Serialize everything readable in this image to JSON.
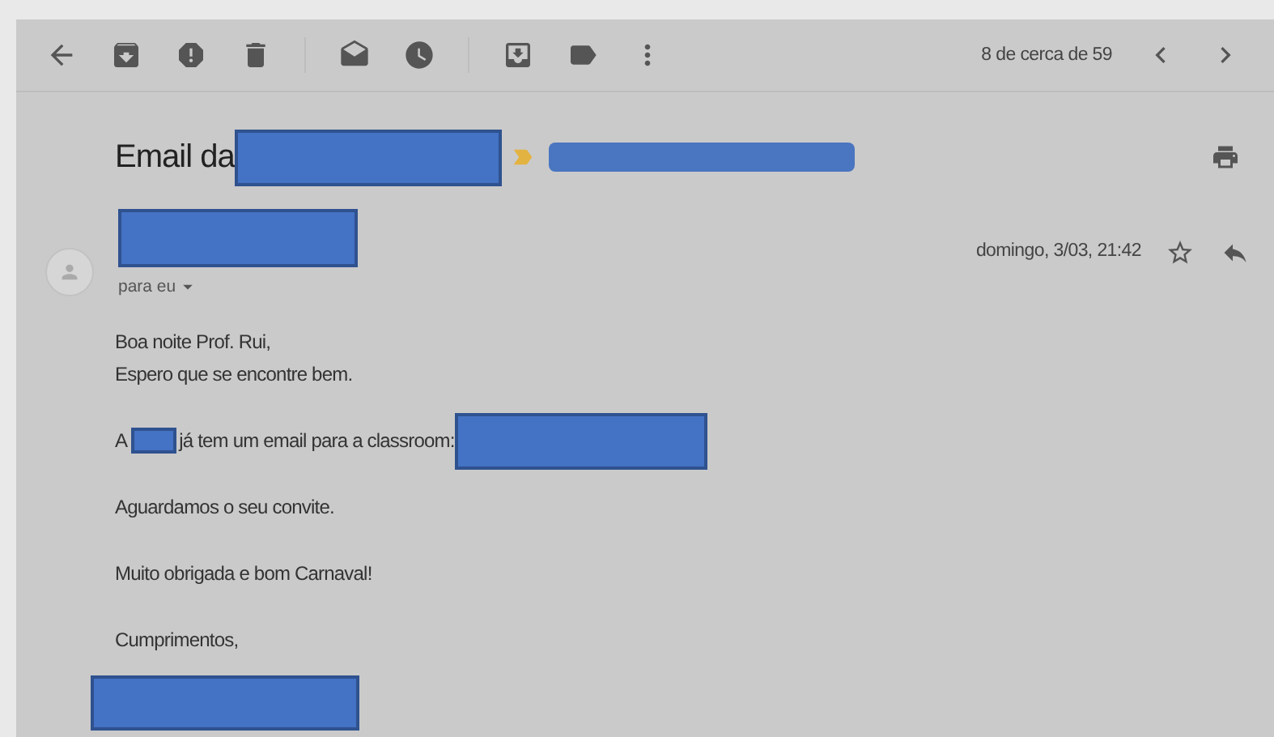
{
  "toolbar": {
    "pager": "8 de cerca de 59"
  },
  "subject": {
    "text": "Email da",
    "important": true
  },
  "message": {
    "recipient": "para eu",
    "date": "domingo, 3/03, 21:42",
    "starred": false
  },
  "body": [
    {
      "kind": "text",
      "lines": [
        "Boa noite Prof. Rui,",
        "Espero que se encontre bem."
      ]
    },
    {
      "kind": "redacted",
      "before": "A",
      "after": "já tem um email para a classroom:"
    },
    {
      "kind": "text",
      "lines": [
        "Aguardamos o seu convite."
      ]
    },
    {
      "kind": "text",
      "lines": [
        "Muito obrigada e bom Carnaval!"
      ]
    },
    {
      "kind": "text",
      "lines": [
        "Cumprimentos,"
      ]
    }
  ]
}
